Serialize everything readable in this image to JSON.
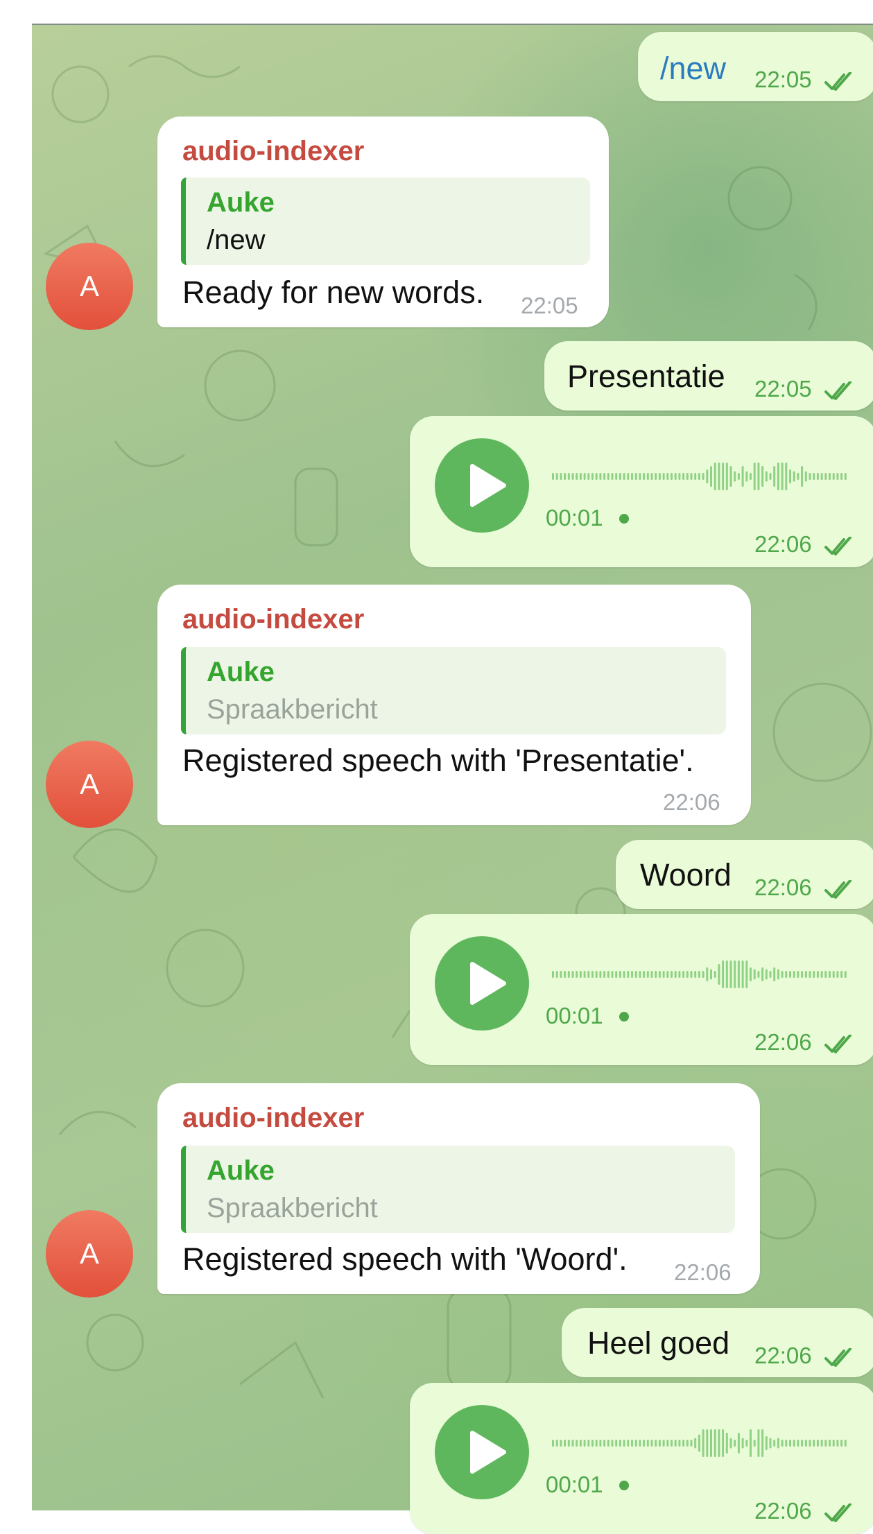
{
  "colors": {
    "incoming_bubble": "#ffffff",
    "outgoing_bubble": "#eafbd8",
    "sender_name": "#c54a3f",
    "reply_name": "#35a530",
    "outgoing_meta": "#4ea84a",
    "avatar": "#e8573f",
    "play_button": "#5fb75d"
  },
  "bot": {
    "name": "audio-indexer",
    "avatar_letter": "A"
  },
  "messages": [
    {
      "type": "outgoing-text",
      "text": "/new",
      "time": "22:05",
      "status": "read-double-check-icon"
    },
    {
      "type": "incoming",
      "sender": "audio-indexer",
      "reply_to": {
        "name": "Auke",
        "text": "/new"
      },
      "text": "Ready for new words.",
      "time": "22:05"
    },
    {
      "type": "outgoing-text",
      "text": "Presentatie",
      "time": "22:05",
      "status": "read-double-check-icon"
    },
    {
      "type": "outgoing-voice",
      "duration": "00:01",
      "time": "22:06",
      "status": "read-double-check-icon"
    },
    {
      "type": "incoming",
      "sender": "audio-indexer",
      "reply_to": {
        "name": "Auke",
        "text": "Spraakbericht"
      },
      "text": "Registered speech with 'Presentatie'.",
      "time": "22:06"
    },
    {
      "type": "outgoing-text",
      "text": "Woord",
      "time": "22:06",
      "status": "read-double-check-icon"
    },
    {
      "type": "outgoing-voice",
      "duration": "00:01",
      "time": "22:06",
      "status": "read-double-check-icon"
    },
    {
      "type": "incoming",
      "sender": "audio-indexer",
      "reply_to": {
        "name": "Auke",
        "text": "Spraakbericht"
      },
      "text": "Registered speech with 'Woord'.",
      "time": "22:06"
    },
    {
      "type": "outgoing-text",
      "text": "Heel goed",
      "time": "22:06",
      "status": "read-double-check-icon"
    },
    {
      "type": "outgoing-voice",
      "duration": "00:01",
      "time": "22:06",
      "status": "read-double-check-icon"
    }
  ]
}
